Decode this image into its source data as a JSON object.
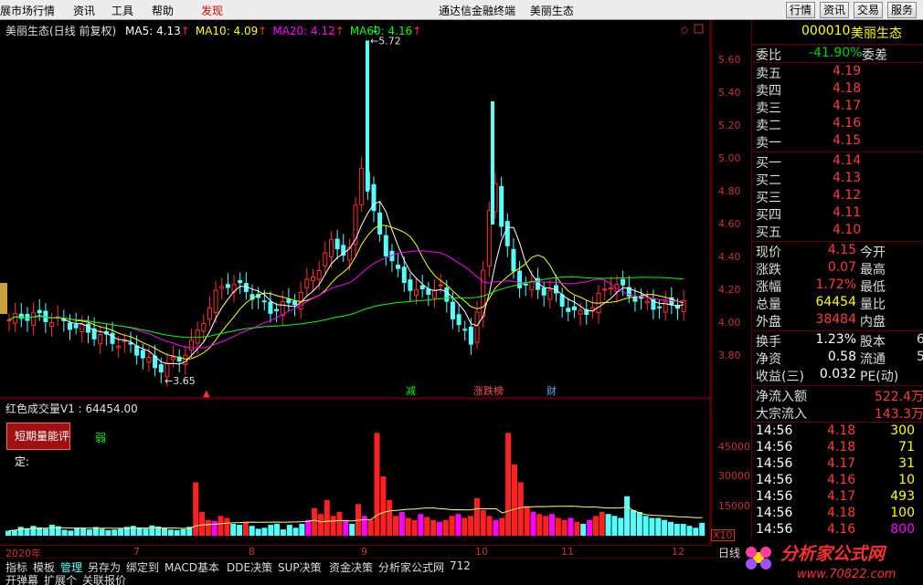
{
  "menu": {
    "items": [
      "展市场行情",
      "资讯",
      "工具",
      "帮助",
      "发现"
    ],
    "active_index": 4,
    "center_title": "通达信金融终端",
    "center_stock": "美丽生态",
    "buttons": [
      "行情",
      "资讯",
      "交易",
      "服务"
    ]
  },
  "kline": {
    "title": "美丽生态(日线 前复权)",
    "ma": [
      {
        "label": "MA5: 4.13",
        "color": "#ffffff"
      },
      {
        "label": "MA10: 4.09",
        "color": "#ffff00"
      },
      {
        "label": "MA20: 4.12",
        "color": "#ff00ff"
      },
      {
        "label": "MA60: 4.16",
        "color": "#00ff00"
      }
    ],
    "high_label": "5.72",
    "low_label": "3.65",
    "y_ticks": [
      "5.60",
      "5.40",
      "5.20",
      "5.00",
      "4.80",
      "4.60",
      "4.40",
      "4.20",
      "4.00",
      "3.80"
    ],
    "markers": [
      {
        "label": "减",
        "color": "#00ff00"
      },
      {
        "label": "涨跌榜",
        "color": "#ff5050"
      },
      {
        "label": "财",
        "color": "#54b0ff"
      }
    ]
  },
  "chart_data": {
    "type": "bar",
    "title": "红色成交量V1 : 64454.00",
    "ylabel": "",
    "y_ticks": [
      "45000",
      "30000",
      "15000"
    ],
    "x_labels": [
      "2020年",
      "7",
      "8",
      "9",
      "10",
      "11",
      "12"
    ],
    "unit_label": "X10",
    "ylim": [
      0,
      60000
    ],
    "series": [
      {
        "values": [
          2500,
          3000,
          4500,
          3800,
          5000,
          4200,
          3500,
          5600,
          4800,
          3000,
          2600,
          4000,
          3700,
          3200,
          4400,
          3500,
          2800,
          3100,
          3500,
          4500,
          5000,
          4200,
          3600,
          5200,
          4600,
          4000,
          3100,
          2800,
          3300,
          4500,
          27000,
          12000,
          8000,
          7500,
          10000,
          9000,
          6000,
          5500,
          7000,
          5000,
          3500,
          4000,
          5500,
          6000,
          3200,
          5500,
          4000,
          6000,
          8000,
          14000,
          11000,
          18000,
          10000,
          12000,
          8000,
          6000,
          16000,
          10000,
          8000,
          52000,
          30000,
          18000,
          10000,
          12000,
          9000,
          8000,
          11000,
          9500,
          8000,
          7000,
          8000,
          10000,
          11000,
          9000,
          10000,
          19000,
          13000,
          10000,
          8000,
          9000,
          52000,
          36000,
          27000,
          15000,
          12000,
          11000,
          10000,
          11000,
          9000,
          8000,
          9000,
          7000,
          6000,
          8000,
          10000,
          12000,
          11000,
          10000,
          9000,
          20000,
          13000,
          12000,
          10000,
          9000,
          9000,
          8000,
          7000,
          6000,
          6000,
          5000,
          4000,
          6500
        ]
      }
    ],
    "colors": {
      "up": "#ff2020",
      "down": "#54ffff",
      "hot": "#ff00ff",
      "ma": "#ffff80"
    }
  },
  "volume_panel": {
    "badge_label": "短期量能评定:",
    "badge_value": "弱"
  },
  "quote": {
    "code": "000010",
    "name": "美丽生态",
    "weibi_label": "委比",
    "weibi_value": "-41.90%",
    "weicha_label": "委差",
    "asks": [
      {
        "label": "卖五",
        "price": "4.19"
      },
      {
        "label": "卖四",
        "price": "4.18"
      },
      {
        "label": "卖三",
        "price": "4.17"
      },
      {
        "label": "卖二",
        "price": "4.16"
      },
      {
        "label": "卖一",
        "price": "4.15"
      }
    ],
    "bids": [
      {
        "label": "买一",
        "price": "4.14"
      },
      {
        "label": "买二",
        "price": "4.13"
      },
      {
        "label": "买三",
        "price": "4.12"
      },
      {
        "label": "买四",
        "price": "4.11"
      },
      {
        "label": "买五",
        "price": "4.10"
      }
    ],
    "stats": [
      {
        "label": "现价",
        "value": "4.15",
        "color": "#ff3b3b",
        "label2": "今开"
      },
      {
        "label": "涨跌",
        "value": "0.07",
        "color": "#ff3b3b",
        "label2": "最高"
      },
      {
        "label": "涨幅",
        "value": "1.72%",
        "color": "#ff3b3b",
        "label2": "最低"
      },
      {
        "label": "总量",
        "value": "64454",
        "color": "#ffff00",
        "label2": "量比"
      },
      {
        "label": "外盘",
        "value": "38484",
        "color": "#ff3b3b",
        "label2": "内盘"
      }
    ],
    "stats2": [
      {
        "label": "换手",
        "value": "1.23%",
        "label2": "股本",
        "extra": "6"
      },
      {
        "label": "净资",
        "value": "0.58",
        "label2": "流通",
        "extra": "5"
      },
      {
        "label": "收益(三)",
        "value": "0.032",
        "label2": "PE(动)",
        "extra": ""
      }
    ],
    "flow": [
      {
        "label": "净流入额",
        "value": "522.4万"
      },
      {
        "label": "大宗流入",
        "value": "143.3万"
      }
    ],
    "ticks": [
      {
        "time": "14:56",
        "price": "4.18",
        "vol": "300",
        "vcolor": "#ffff00"
      },
      {
        "time": "14:56",
        "price": "4.18",
        "vol": "71",
        "vcolor": "#ffff00"
      },
      {
        "time": "14:56",
        "price": "4.17",
        "vol": "31",
        "vcolor": "#ffff00"
      },
      {
        "time": "14:56",
        "price": "4.16",
        "vol": "10",
        "vcolor": "#ffff00"
      },
      {
        "time": "14:56",
        "price": "4.17",
        "vol": "493",
        "vcolor": "#ffff00"
      },
      {
        "time": "14:56",
        "price": "4.18",
        "vol": "100",
        "vcolor": "#ffff00"
      },
      {
        "time": "14:56",
        "price": "4.16",
        "vol": "800",
        "vcolor": "#ff00ff"
      }
    ]
  },
  "bottom_tabs": [
    "指标",
    "模板",
    "管理",
    "另存为",
    "绑定到",
    "MACD基本",
    "DDE决策",
    "SUP决策",
    "资金决策",
    "分析家公式网",
    "712"
  ],
  "bottom_tabs_active": 2,
  "bottom_tabs2": [
    "开弹幕",
    "扩展个",
    "关联报价"
  ],
  "period_label": "日线",
  "watermark": {
    "name": "分析家公式网",
    "url": "www.70822.com"
  }
}
